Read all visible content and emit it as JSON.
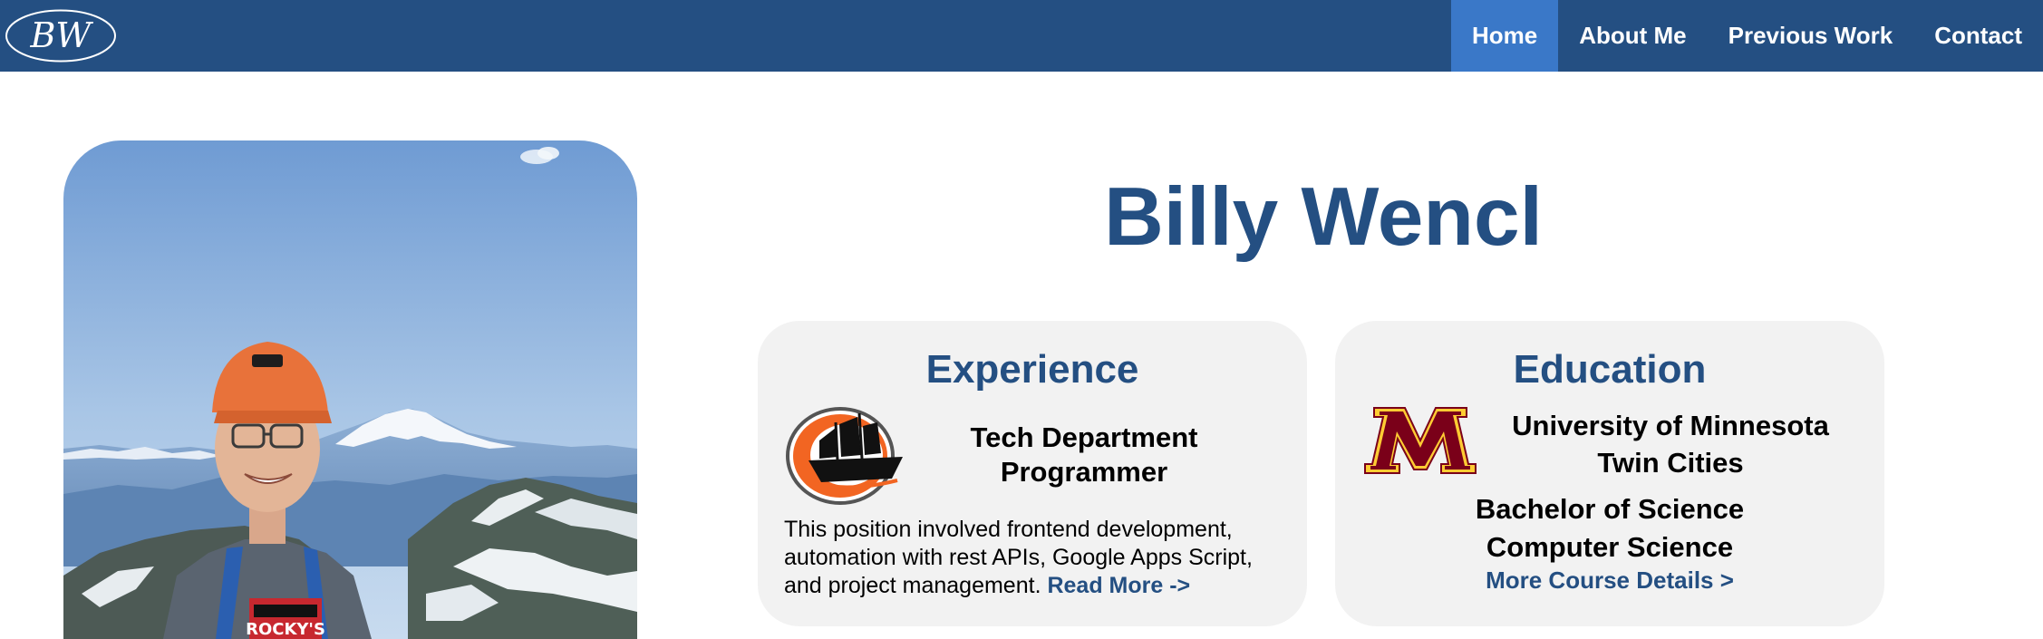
{
  "header": {
    "logo_text": "BW",
    "nav": [
      {
        "label": "Home",
        "active": true
      },
      {
        "label": "About Me",
        "active": false
      },
      {
        "label": "Previous Work",
        "active": false
      },
      {
        "label": "Contact",
        "active": false
      }
    ]
  },
  "hero": {
    "name": "Billy Wencl",
    "photo_icon": "profile-photo-mountains"
  },
  "experience": {
    "title": "Experience",
    "logo_icon": "pirate-ship-logo-icon",
    "job_title_lines": [
      "Tech Department",
      "Programmer"
    ],
    "description": "This position involved frontend development, automation with rest APIs, Google Apps Script, and project management.",
    "read_more": "Read More ->"
  },
  "education": {
    "title": "Education",
    "logo_icon": "university-m-logo-icon",
    "university_lines": [
      "University of Minnesota",
      "Twin Cities"
    ],
    "degree_lines": [
      "Bachelor of Science",
      "Computer Science"
    ],
    "course_link": "More Course Details >"
  },
  "colors": {
    "navbar": "#244f82",
    "nav_active": "#3a78c8",
    "accent_text": "#244f82",
    "card_bg": "#f2f2f2",
    "maroon": "#7a0019",
    "gold": "#ffcc33",
    "orange": "#f26522"
  }
}
